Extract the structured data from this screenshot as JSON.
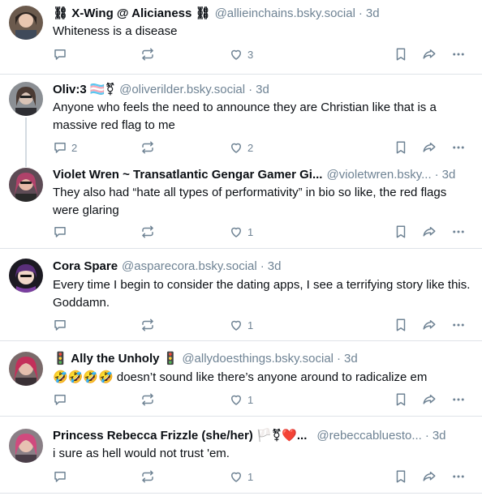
{
  "posts": [
    {
      "name": "⛓ X-Wing @ Alicianess ⛓",
      "handle": "@allieinchains.bsky.social",
      "time": "3d",
      "text": "Whiteness is a disease",
      "replies": "",
      "reposts": "",
      "likes": "3"
    },
    {
      "name": "Oliv:3 🏳️‍⚧️⚧",
      "handle": "@oliverilder.bsky.social",
      "time": "3d",
      "text": "Anyone who feels the need to announce they are Christian like that is a massive red flag to me",
      "replies": "2",
      "reposts": "",
      "likes": "2"
    },
    {
      "name": "Violet Wren ~ Transatlantic Gengar Gamer Gi...",
      "handle": "@violetwren.bsky...",
      "time": "3d",
      "text": "They also had “hate all types of performativity” in bio so like, the red flags were glaring",
      "replies": "",
      "reposts": "",
      "likes": "1"
    },
    {
      "name": "Cora Spare",
      "handle": "@asparecora.bsky.social",
      "time": "3d",
      "text": "Every time I begin to consider the dating apps, I see a terrifying story like this. Goddamn.",
      "replies": "",
      "reposts": "",
      "likes": "1"
    },
    {
      "name": "🚦 Ally the Unholy 🚦",
      "handle": "@allydoesthings.bsky.social",
      "time": "3d",
      "text": "🤣🤣🤣🤣 doesn’t sound like there’s anyone around to radicalize em",
      "replies": "",
      "reposts": "",
      "likes": "1"
    },
    {
      "name": "Princess Rebecca Frizzle (she/her) 🏳️⚧❤️...",
      "handle": "@rebeccabluesto...",
      "time": "3d",
      "text": "i sure as hell would not trust 'em.",
      "replies": "",
      "reposts": "",
      "likes": "1"
    }
  ],
  "separator": "·",
  "colors": {
    "text": "#0b0f14",
    "muted": "#6f8394",
    "divider": "#dfe3e8",
    "thread_line": "#d4dbe2"
  },
  "icons": [
    "reply-icon",
    "repost-icon",
    "like-icon",
    "bookmark-icon",
    "share-icon",
    "more-icon"
  ]
}
